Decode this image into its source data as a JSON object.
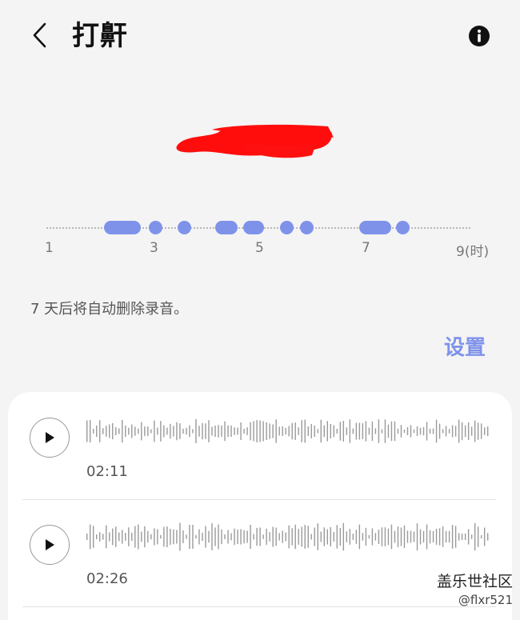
{
  "header": {
    "title": "打鼾",
    "back_icon": "chevron-left-icon",
    "info_icon": "info-icon"
  },
  "timeline": {
    "accent_color": "#7f92ea",
    "tick_labels": [
      "1",
      "3",
      "5",
      "7",
      "9(时)"
    ],
    "range_hours": [
      1,
      9
    ]
  },
  "notice": {
    "text": "7 天后将自动删除录音。"
  },
  "settings": {
    "label": "设置"
  },
  "recordings": [
    {
      "duration": "02:11",
      "play_icon": "play-icon"
    },
    {
      "duration": "02:26",
      "play_icon": "play-icon"
    }
  ],
  "watermark": {
    "title": "盖乐世社区",
    "user": "@flxr521"
  }
}
